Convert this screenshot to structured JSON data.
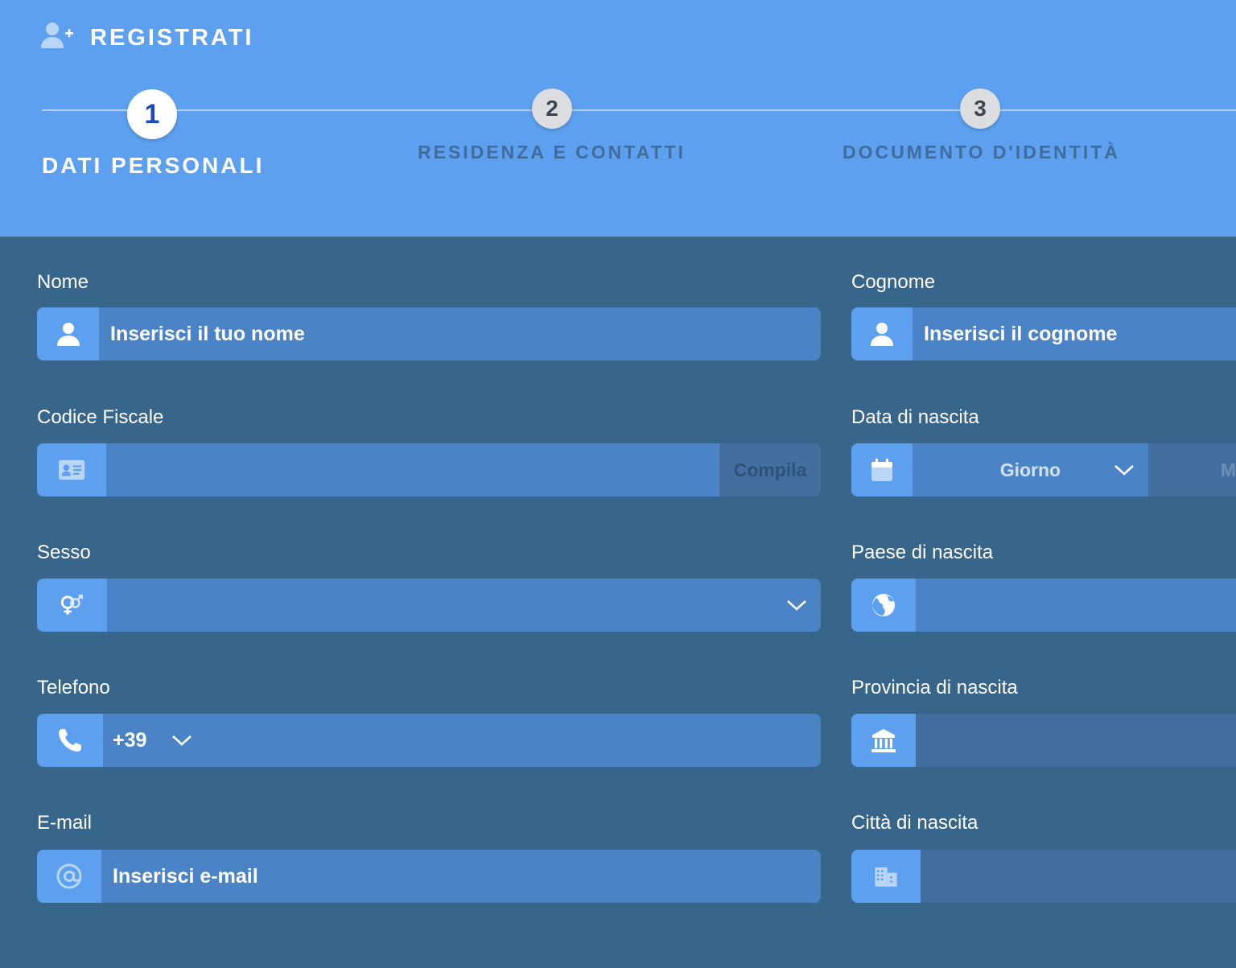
{
  "header": {
    "title": "REGISTRATI",
    "title_icon": "user-plus-icon",
    "steps": [
      {
        "number": "1",
        "label": "DATI PERSONALI",
        "active": true
      },
      {
        "number": "2",
        "label": "RESIDENZA E CONTATTI",
        "active": false
      },
      {
        "number": "3",
        "label": "DOCUMENTO D'IDENTITÀ",
        "active": false
      }
    ]
  },
  "form": {
    "nome": {
      "label": "Nome",
      "placeholder": "Inserisci il tuo nome",
      "icon": "user-icon"
    },
    "cognome": {
      "label": "Cognome",
      "placeholder": "Inserisci il cognome",
      "icon": "user-icon"
    },
    "codice_fiscale": {
      "label": "Codice Fiscale",
      "button": "Compila",
      "icon": "id-card-icon"
    },
    "data_nascita": {
      "label": "Data di nascita",
      "day_placeholder": "Giorno",
      "month_partial": "M",
      "icon": "calendar-icon"
    },
    "sesso": {
      "label": "Sesso",
      "icon": "gender-icon"
    },
    "paese_nascita": {
      "label": "Paese di nascita",
      "icon": "globe-icon"
    },
    "telefono": {
      "label": "Telefono",
      "prefix": "+39",
      "icon": "phone-icon"
    },
    "provincia_nascita": {
      "label": "Provincia di nascita",
      "icon": "bank-icon"
    },
    "email": {
      "label": "E-mail",
      "placeholder": "Inserisci e-mail",
      "icon": "at-icon"
    },
    "citta_nascita": {
      "label": "Città di nascita",
      "icon": "city-icon"
    }
  },
  "colors": {
    "header_bg": "#5ca0ef",
    "body_bg": "#38658a",
    "field_bg": "#4b84c6",
    "active_step": "#1d49c4"
  }
}
